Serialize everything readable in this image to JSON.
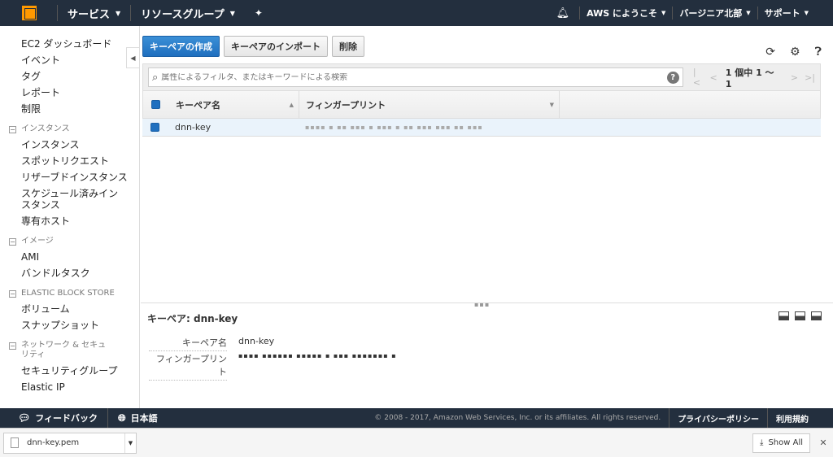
{
  "topnav": {
    "services": "サービス",
    "resource_groups": "リソースグループ",
    "account": "AWS にようこそ",
    "region": "バージニア北部",
    "support": "サポート"
  },
  "sidebar": {
    "items": [
      "EC2 ダッシュボード",
      "イベント",
      "タグ",
      "レポート",
      "制限"
    ],
    "instances_section": "インスタンス",
    "instances_items": [
      "インスタンス",
      "スポットリクエスト",
      "リザーブドインスタンス",
      "スケジュール済みインスタンス",
      "専有ホスト"
    ],
    "images_section": "イメージ",
    "images_items": [
      "AMI",
      "バンドルタスク"
    ],
    "ebs_section": "ELASTIC BLOCK STORE",
    "ebs_items": [
      "ボリューム",
      "スナップショット"
    ],
    "network_section": "ネットワーク & セキュリティ",
    "network_items": [
      "セキュリティグループ",
      "Elastic IP"
    ]
  },
  "toolbar": {
    "create": "キーペアの作成",
    "import": "キーペアのインポート",
    "delete": "削除"
  },
  "search": {
    "placeholder": "属性によるフィルタ、またはキーワードによる検索"
  },
  "pager": {
    "count": "1 個中 1 〜 1"
  },
  "table": {
    "headers": [
      "キーペア名",
      "フィンガープリント"
    ],
    "rows": [
      {
        "name": "dnn-key"
      }
    ]
  },
  "detail": {
    "title": "キーペア: dnn-key",
    "name_label": "キーペア名",
    "name_value": "dnn-key",
    "fingerprint_label": "フィンガープリント"
  },
  "footer": {
    "feedback": "フィードバック",
    "language": "日本語",
    "copyright": "© 2008 - 2017, Amazon Web Services, Inc. or its affiliates. All rights reserved.",
    "privacy": "プライバシーポリシー",
    "terms": "利用規約"
  },
  "downloads": {
    "file": "dnn-key.pem",
    "show_all": "Show All"
  }
}
